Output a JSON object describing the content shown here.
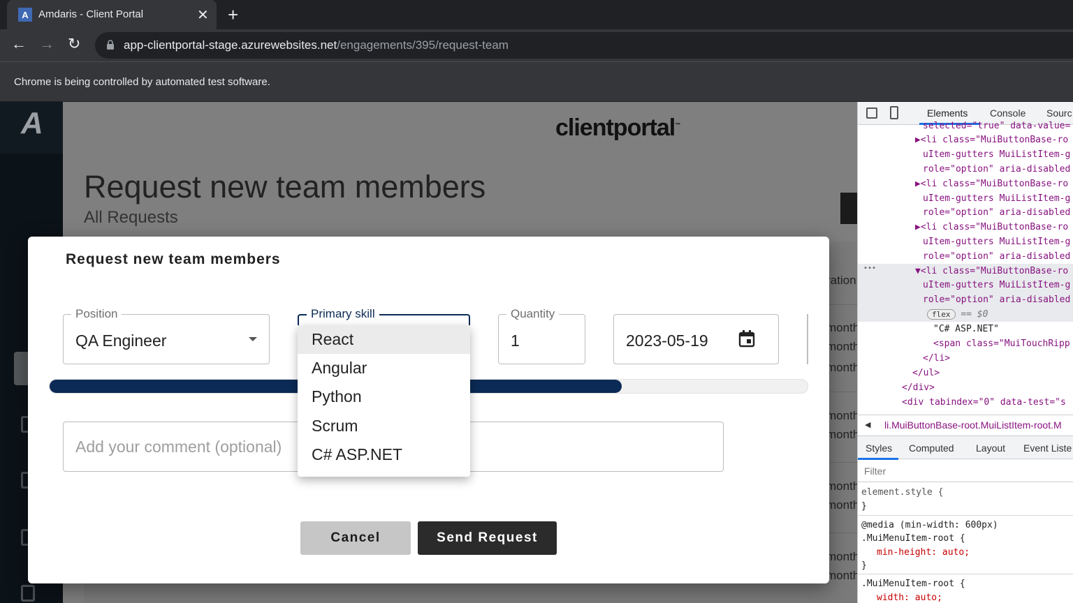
{
  "browser": {
    "tab_title": "Amdaris - Client Portal",
    "favicon_letter": "A",
    "close_glyph": "✕",
    "new_tab_glyph": "+",
    "back_glyph": "←",
    "forward_glyph": "→",
    "reload_glyph": "↻",
    "url_host": "app-clientportal-stage.azurewebsites.net",
    "url_path": "/engagements/395/request-team",
    "infobar_text": "Chrome is being controlled by automated test software."
  },
  "app": {
    "logo_letter": "A",
    "brand": "clientportal",
    "brand_tm": "™",
    "page_title": "Request new team members",
    "page_subtitle": "All Requests",
    "duration_header": "ration",
    "duration_values": [
      "month",
      "month",
      "month",
      "month",
      "month",
      "month",
      "month",
      "month",
      "month"
    ]
  },
  "modal": {
    "title": "Request new team members",
    "position_label": "Position",
    "position_value": "QA Engineer",
    "skill_label": "Primary skill",
    "quantity_label": "Quantity",
    "quantity_value": "1",
    "date_value": "2023-05-19",
    "comment_placeholder": "Add your comment (optional)",
    "progress_fraction": 0.755,
    "cancel_label": "Cancel",
    "send_label": "Send Request",
    "skill_options": [
      "React",
      "Angular",
      "Python",
      "Scrum",
      "C# ASP.NET"
    ],
    "selected_option_index": 0
  },
  "devtools": {
    "tabs": [
      "Elements",
      "Console",
      "Sourc"
    ],
    "code_lines": [
      "selected=\"true\" data-value=",
      "▶<li class=\"MuiButtonBase-ro",
      "uItem-gutters MuiListItem-g",
      "role=\"option\" aria-disabled",
      "▶<li class=\"MuiButtonBase-ro",
      "uItem-gutters MuiListItem-g",
      "role=\"option\" aria-disabled",
      "▶<li class=\"MuiButtonBase-ro",
      "uItem-gutters MuiListItem-g",
      "role=\"option\" aria-disabled",
      "▼<li class=\"MuiButtonBase-ro",
      "uItem-gutters MuiListItem-g",
      "role=\"option\" aria-disabled",
      "== $0",
      "\"C# ASP.NET\"",
      "<span class=\"MuiTouchRipp",
      "</li>",
      "</ul>",
      "</div>",
      "<div tabindex=\"0\" data-test=\"s"
    ],
    "ellipsis": "•••",
    "flex_badge": "flex",
    "breadcrumb": "li.MuiButtonBase-root.MuiListItem-root.M",
    "crumb_arrow": "◀",
    "subtabs": [
      "Styles",
      "Computed",
      "Layout",
      "Event Liste"
    ],
    "filter_placeholder": "Filter",
    "style_lines": [
      "element.style {",
      "}",
      "@media (min-width: 600px)",
      ".MuiMenuItem-root {",
      "min-height: auto;",
      "}",
      ".MuiMenuItem-root {",
      "width: auto;"
    ]
  }
}
